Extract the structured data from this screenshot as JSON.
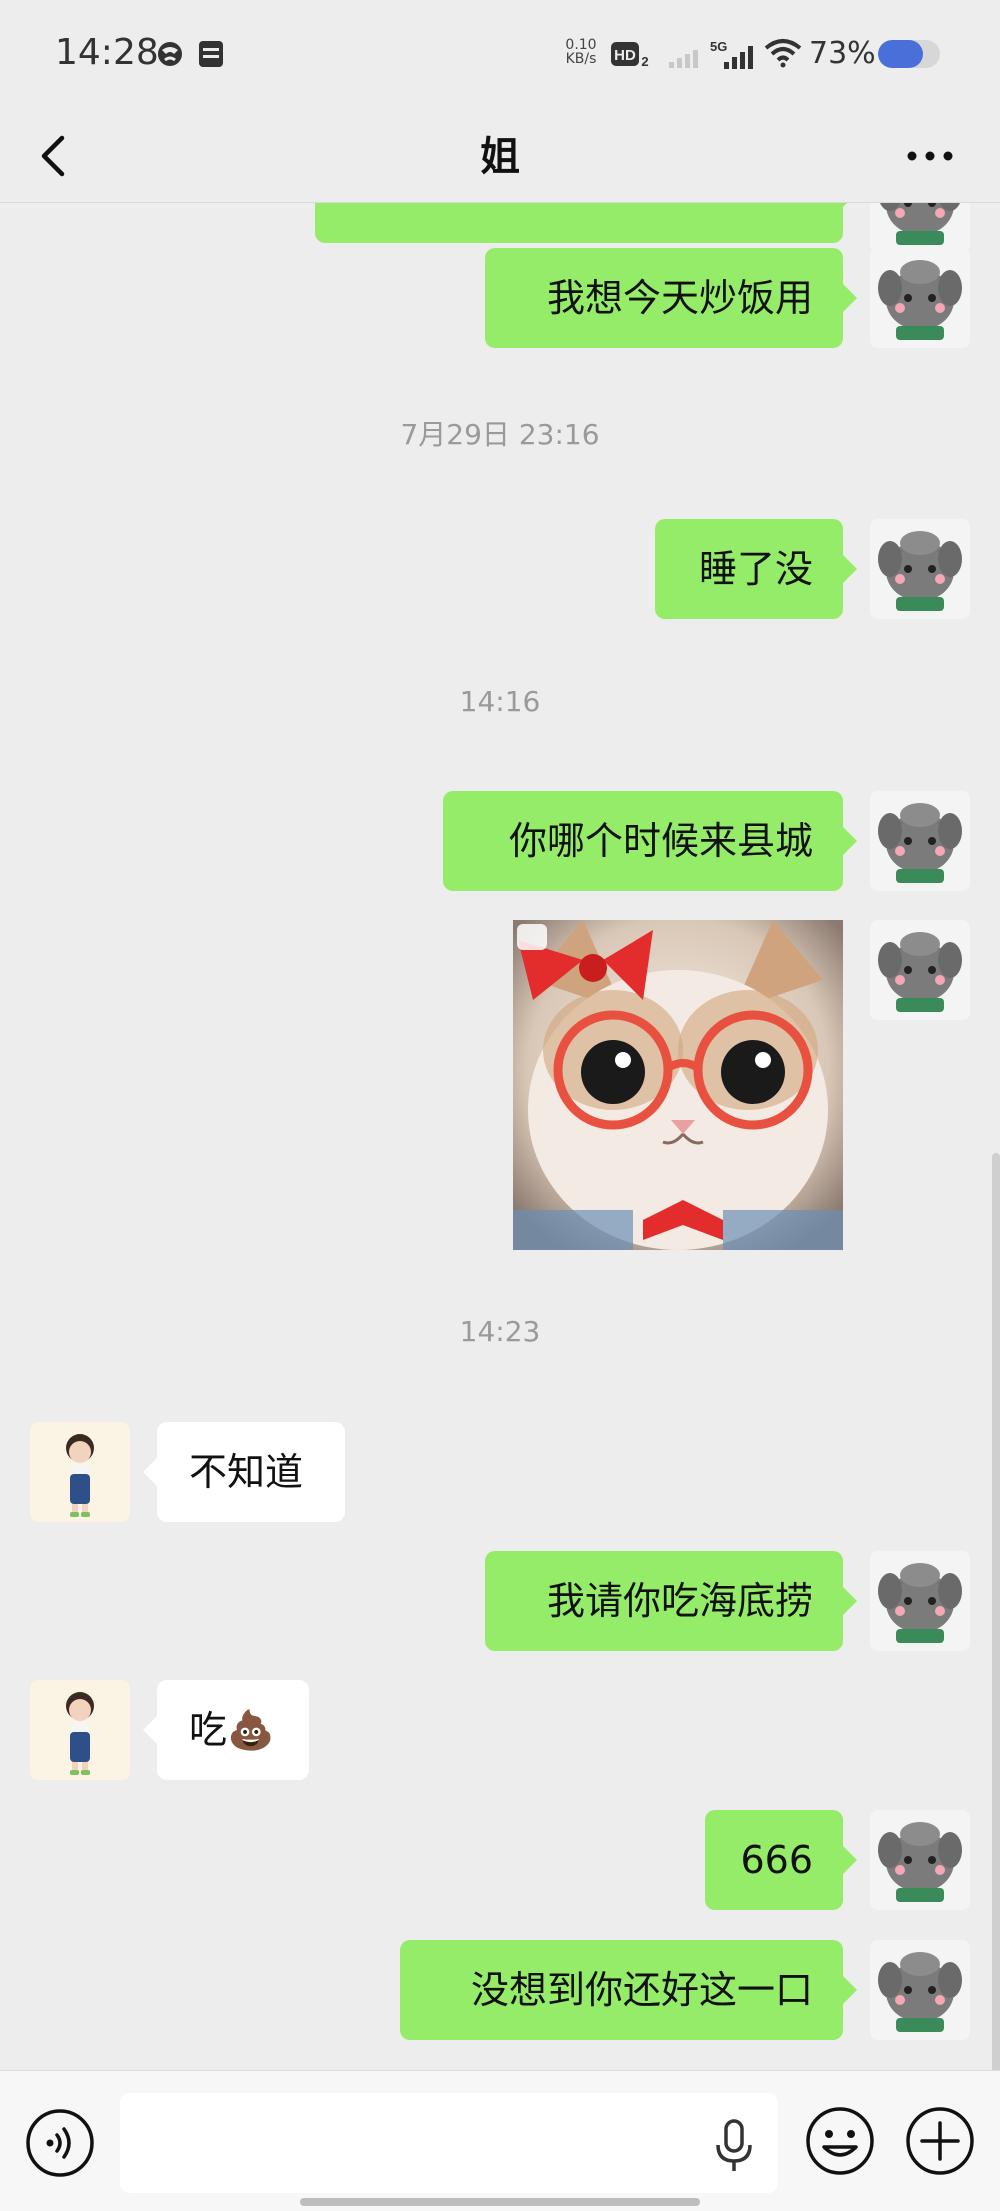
{
  "status_bar": {
    "time": "14:28",
    "net_speed_value": "0.10",
    "net_speed_unit": "KB/s",
    "hd_label": "HD",
    "network": "5G",
    "battery_text": "73%",
    "battery_level": 0.73
  },
  "header": {
    "title": "姐"
  },
  "messages": [
    {
      "type": "text",
      "from": "me",
      "text": "我想今天炒饭用"
    },
    {
      "type": "timestamp",
      "text": "7月29日 23:16"
    },
    {
      "type": "text",
      "from": "me",
      "text": "睡了没"
    },
    {
      "type": "timestamp",
      "text": "14:16"
    },
    {
      "type": "text",
      "from": "me",
      "text": "你哪个时候来县城"
    },
    {
      "type": "sticker",
      "from": "me",
      "description_icon": "cat-glasses-sticker"
    },
    {
      "type": "timestamp",
      "text": "14:23"
    },
    {
      "type": "text",
      "from": "her",
      "text": "不知道"
    },
    {
      "type": "text",
      "from": "me",
      "text": "我请你吃海底捞"
    },
    {
      "type": "text",
      "from": "her",
      "text": "吃💩"
    },
    {
      "type": "text",
      "from": "me",
      "text": "666"
    },
    {
      "type": "text",
      "from": "me",
      "text": "没想到你还好这一口"
    }
  ],
  "input": {
    "value": "",
    "placeholder": ""
  },
  "colors": {
    "my_bubble": "#95ec69",
    "her_bubble": "#ffffff",
    "background": "#ededed",
    "battery": "#4a6fd8"
  }
}
